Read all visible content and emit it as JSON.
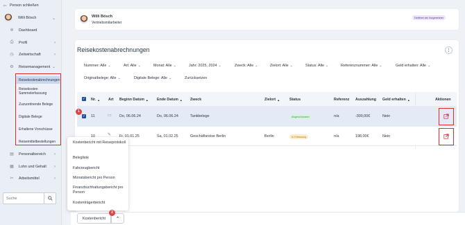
{
  "sidebar": {
    "close_label": "Person schließen",
    "user_name": "Willi Bösch",
    "items": [
      {
        "label": "Dashboard",
        "icon": "dashboard-icon"
      },
      {
        "label": "Profil",
        "icon": "profile-icon"
      },
      {
        "label": "Zeitwirtschaft",
        "icon": "clock-icon"
      },
      {
        "label": "Reisemanagement",
        "icon": "travel-icon"
      },
      {
        "label": "Personalbereich",
        "icon": "personnel-icon"
      },
      {
        "label": "Lohn und Gehalt",
        "icon": "salary-icon"
      },
      {
        "label": "Arbeitsmittel",
        "icon": "tools-icon"
      }
    ],
    "subitems": [
      "Reisekostenabrechnungen",
      "Reisekosten Sammelerfassung",
      "Zuzuordnende Belege",
      "Digitale Belege",
      "Erhaltene Vorschüsse",
      "Reisemittelbestellungen"
    ],
    "search_placeholder": "Suche"
  },
  "header": {
    "name": "Willi Bösch",
    "role": "Vertriebsmitarbeiter",
    "badge": "Delifinet als Vorgesetzter"
  },
  "main": {
    "title": "Reisekostenabrechnungen",
    "filters_row1": [
      "Nummer: Alle",
      "Art: Alle",
      "Monat: Alle",
      "Jahr: 2025, 2024",
      "Zweck: Alle",
      "Zielort: Alle",
      "Status: Alle",
      "Referenznummer: Alle",
      "Geld erhalten: Alle"
    ],
    "filters_row2": [
      "Originalbelege: Alle",
      "Digitale Belege: Alle"
    ],
    "reset_label": "Zurücksetzen"
  },
  "table": {
    "columns": [
      "Nr.",
      "Art",
      "Beginn Datum",
      "Ende Datum",
      "Zweck",
      "Zielort",
      "Status",
      "Referenz",
      "Auszahlung",
      "Geld erhalten",
      "Aktionen"
    ],
    "rows": [
      {
        "nr": "11",
        "begin": "Do, 06.06.24",
        "end": "Do, 06.06.24",
        "zweck": "Tankbelege",
        "zielort": "",
        "status": "Abgeschlossen",
        "status_color": "#3c9a54",
        "status_bg": "#dcf1e2",
        "referenz": "n/a",
        "auszahlung": "-300,00€",
        "geld": "Nein"
      },
      {
        "nr": "10",
        "begin": "Fr, 01.01.25",
        "end": "Sa, 01.02.25",
        "zweck": "Geschäftsreise Berlin",
        "zielort": "Berlin",
        "status": "In Erfassung",
        "status_color": "#b7791f",
        "status_bg": "#fbeccb",
        "referenz": "n/a",
        "auszahlung": "198,00€",
        "geld": "Nein"
      }
    ]
  },
  "menu": {
    "items": [
      "Kostenbericht mit Reiseprotokoll",
      "Belegliste",
      "Fahrzeugbericht",
      "Monatsbericht pro Person",
      "Finanzbuchhaltungsbericht pro Person",
      "Kostenträgerbericht"
    ]
  },
  "footer": {
    "report_button": "Kostenbericht"
  },
  "markers": [
    "1",
    "2"
  ],
  "colors": {
    "accent": "#1f4e9c",
    "highlight": "#e02b2b",
    "active_bg": "#c9d6ee"
  }
}
